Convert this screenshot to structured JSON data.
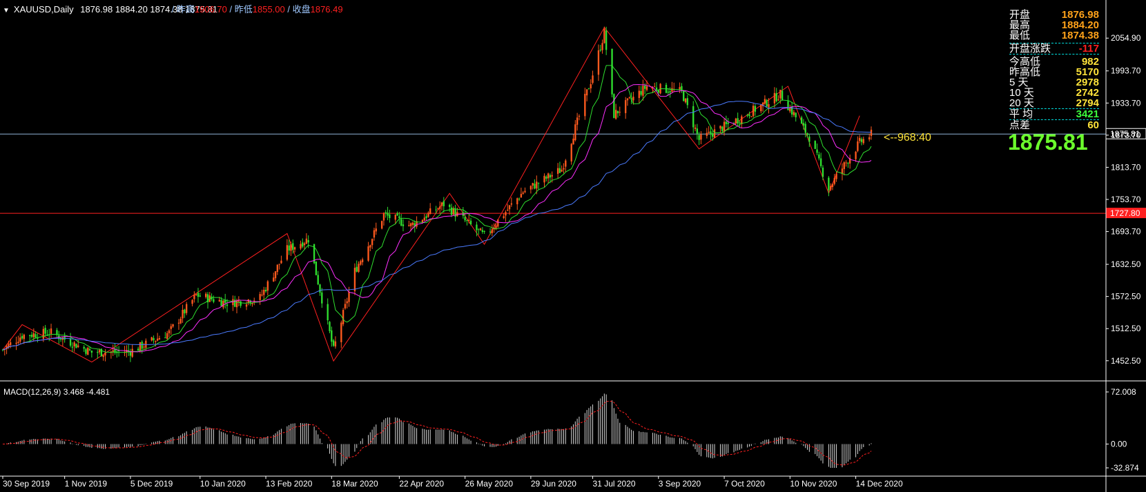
{
  "symbol_header": {
    "symbol": "XAUUSD,Daily",
    "ohlc": "1876.98 1884.20 1874.38 1875.81",
    "prev_high_label": "/ 昨高",
    "prev_high": "1906.70",
    "prev_low_label": "/ 昨低",
    "prev_low": "1855.00",
    "close_label": "/ 收盘",
    "close": "1876.49"
  },
  "info_panel": [
    {
      "label": "开盘",
      "value": "1876.98",
      "color": "#ffa21a"
    },
    {
      "label": "最高",
      "value": "1884.20",
      "color": "#ffa21a"
    },
    {
      "label": "最低",
      "value": "1874.38",
      "color": "#ffa21a"
    },
    {
      "label": "开盘涨跌",
      "value": "-117",
      "color": "#ff2020"
    },
    {
      "label": "今高低",
      "value": "982",
      "color": "#ffe43a"
    },
    {
      "label": "昨高低",
      "value": "5170",
      "color": "#ffe43a"
    },
    {
      "label": "5 天",
      "value": "2978",
      "color": "#ffe43a"
    },
    {
      "label": "10 天",
      "value": "2742",
      "color": "#ffe43a"
    },
    {
      "label": "20 天",
      "value": "2794",
      "color": "#ffe43a"
    },
    {
      "label": "平 均",
      "value": "3421",
      "color": "#3cff3c"
    },
    {
      "label": "点差",
      "value": "60",
      "color": "#ffe43a"
    }
  ],
  "current_price": "1875.81",
  "annotation": "<--968:40",
  "macd_label": "MACD(12,26,9) 3.468 -4.481",
  "chart_data": [
    {
      "type": "candlestick",
      "price_axis": {
        "min": 1420,
        "max": 2090,
        "ticks": [
          "2054.90",
          "1993.70",
          "1933.70",
          "1873.70",
          "1813.70",
          "1753.70",
          "1693.70",
          "1632.50",
          "1572.50",
          "1512.50",
          "1452.50"
        ]
      },
      "current_price_label": "1875.81",
      "horizontal_line": {
        "value": 1727.8,
        "label": "1727.80",
        "color": "#ff2020"
      },
      "x_ticks": [
        "30 Sep 2019",
        "1 Nov 2019",
        "5 Dec 2019",
        "10 Jan 2020",
        "13 Feb 2020",
        "18 Mar 2020",
        "22 Apr 2020",
        "26 May 2020",
        "29 Jun 2020",
        "31 Jul 2020",
        "3 Sep 2020",
        "7 Oct 2020",
        "10 Nov 2020",
        "14 Dec 2020"
      ],
      "key_closes": [
        {
          "date": "2019-09-30",
          "close": 1473
        },
        {
          "date": "2019-10-10",
          "close": 1500
        },
        {
          "date": "2019-10-25",
          "close": 1505
        },
        {
          "date": "2019-11-15",
          "close": 1468
        },
        {
          "date": "2019-12-05",
          "close": 1470
        },
        {
          "date": "2019-12-25",
          "close": 1505
        },
        {
          "date": "2020-01-08",
          "close": 1575
        },
        {
          "date": "2020-01-25",
          "close": 1560
        },
        {
          "date": "2020-02-10",
          "close": 1570
        },
        {
          "date": "2020-02-24",
          "close": 1660
        },
        {
          "date": "2020-03-06",
          "close": 1680
        },
        {
          "date": "2020-03-19",
          "close": 1472
        },
        {
          "date": "2020-03-30",
          "close": 1620
        },
        {
          "date": "2020-04-14",
          "close": 1725
        },
        {
          "date": "2020-04-28",
          "close": 1705
        },
        {
          "date": "2020-05-15",
          "close": 1745
        },
        {
          "date": "2020-06-05",
          "close": 1685
        },
        {
          "date": "2020-06-25",
          "close": 1768
        },
        {
          "date": "2020-07-15",
          "close": 1810
        },
        {
          "date": "2020-07-30",
          "close": 1975
        },
        {
          "date": "2020-08-06",
          "close": 2065
        },
        {
          "date": "2020-08-11",
          "close": 1912
        },
        {
          "date": "2020-08-28",
          "close": 1965
        },
        {
          "date": "2020-09-15",
          "close": 1955
        },
        {
          "date": "2020-09-24",
          "close": 1865
        },
        {
          "date": "2020-10-15",
          "close": 1905
        },
        {
          "date": "2020-11-05",
          "close": 1950
        },
        {
          "date": "2020-11-20",
          "close": 1870
        },
        {
          "date": "2020-11-30",
          "close": 1775
        },
        {
          "date": "2020-12-16",
          "close": 1860
        },
        {
          "date": "2020-12-22",
          "close": 1875
        }
      ],
      "moving_averages": [
        "green",
        "magenta",
        "blue"
      ]
    },
    {
      "type": "bar",
      "name": "MACD(12,26,9)",
      "values_label": "3.468 -4.481",
      "y_ticks": [
        "72.008",
        "0.00",
        "-32.874"
      ],
      "ylim": [
        -32.874,
        72.008
      ]
    }
  ]
}
